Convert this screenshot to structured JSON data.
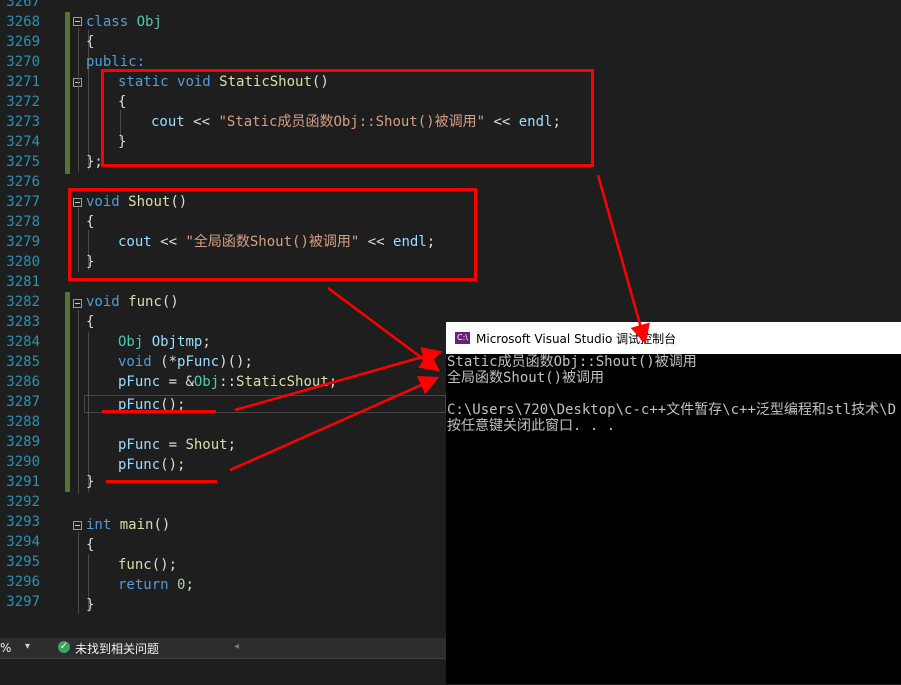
{
  "editor": {
    "line_numbers": [
      "3267",
      "3268",
      "3269",
      "3270",
      "3271",
      "3272",
      "3273",
      "3274",
      "3275",
      "3276",
      "3277",
      "3278",
      "3279",
      "3280",
      "3281",
      "3282",
      "3283",
      "3284",
      "3285",
      "3286",
      "3287",
      "3288",
      "3289",
      "3290",
      "3291",
      "3292",
      "3293",
      "3294",
      "3295",
      "3296",
      "3297"
    ],
    "lines": {
      "l3268_class": "class",
      "l3268_name": "Obj",
      "l3269": "{",
      "l3270": "public:",
      "l3271_static": "static",
      "l3271_void": "void",
      "l3271_fn": "StaticShout",
      "l3271_paren": "()",
      "l3272": "{",
      "l3273_cout": "cout",
      "l3273_op1": " << ",
      "l3273_str": "\"Static成员函数Obj::Shout()被调用\"",
      "l3273_op2": " << ",
      "l3273_endl": "endl",
      "l3273_semi": ";",
      "l3274": "}",
      "l3275": "};",
      "l3277_void": "void",
      "l3277_fn": "Shout",
      "l3277_paren": "()",
      "l3278": "{",
      "l3279_cout": "cout",
      "l3279_op1": " << ",
      "l3279_str": "\"全局函数Shout()被调用\"",
      "l3279_op2": " << ",
      "l3279_endl": "endl",
      "l3279_semi": ";",
      "l3280": "}",
      "l3282_void": "void",
      "l3282_fn": "func",
      "l3282_paren": "()",
      "l3283": "{",
      "l3284_type": "Obj",
      "l3284_var": "Objtmp",
      "l3284_semi": ";",
      "l3285_void": "void",
      "l3285_open": " (*",
      "l3285_var": "pFunc",
      "l3285_rest": ")();",
      "l3286_var": "pFunc",
      "l3286_eq": " = &",
      "l3286_type": "Obj",
      "l3286_colon": "::",
      "l3286_fn": "StaticShout",
      "l3286_semi": ";",
      "l3287_var": "pFunc",
      "l3287_rest": "();",
      "l3289_var": "pFunc",
      "l3289_eq": " = ",
      "l3289_fn": "Shout",
      "l3289_semi": ";",
      "l3290_var": "pFunc",
      "l3290_rest": "();",
      "l3291": "}",
      "l3293_int": "int",
      "l3293_fn": "main",
      "l3293_paren": "()",
      "l3294": "{",
      "l3295_fn": "func",
      "l3295_rest": "();",
      "l3296_ret": "return",
      "l3296_num": "0",
      "l3296_semi": ";",
      "l3297": "}"
    }
  },
  "status": {
    "zoom": "%",
    "issues_text": "未找到相关问题"
  },
  "console": {
    "title": "Microsoft Visual Studio 调试控制台",
    "lines": [
      "Static成员函数Obj::Shout()被调用",
      "全局函数Shout()被调用",
      "",
      "C:\\Users\\720\\Desktop\\c-c++文件暂存\\c++泛型编程和stl技术\\D",
      "按任意键关闭此窗口. . ."
    ]
  },
  "colors": {
    "annotation_red": "#ff0000",
    "editor_bg": "#1e1e1e",
    "console_bg": "#000000"
  }
}
